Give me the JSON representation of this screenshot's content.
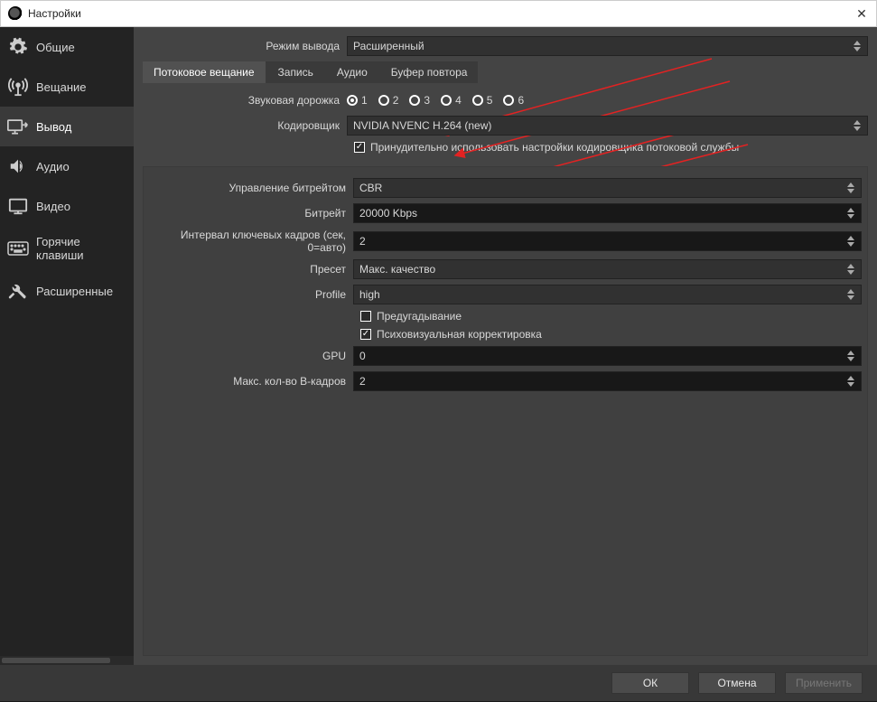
{
  "window": {
    "title": "Настройки"
  },
  "sidebar": {
    "items": [
      {
        "label": "Общие"
      },
      {
        "label": "Вещание"
      },
      {
        "label": "Вывод"
      },
      {
        "label": "Аудио"
      },
      {
        "label": "Видео"
      },
      {
        "label": "Горячие клавиши"
      },
      {
        "label": "Расширенные"
      }
    ],
    "active_index": 2
  },
  "output_mode": {
    "label": "Режим вывода",
    "value": "Расширенный"
  },
  "tabs": [
    {
      "label": "Потоковое вещание"
    },
    {
      "label": "Запись"
    },
    {
      "label": "Аудио"
    },
    {
      "label": "Буфер повтора"
    }
  ],
  "active_tab_index": 0,
  "audio_track": {
    "label": "Звуковая дорожка",
    "options": [
      "1",
      "2",
      "3",
      "4",
      "5",
      "6"
    ],
    "selected_index": 0
  },
  "encoder": {
    "label": "Кодировщик",
    "value": "NVIDIA NVENC H.264 (new)"
  },
  "enforce_checkbox": {
    "checked": true,
    "label": "Принудительно использовать настройки кодировщика потоковой службы"
  },
  "panel": {
    "rate_control": {
      "label": "Управление битрейтом",
      "value": "CBR"
    },
    "bitrate": {
      "label": "Битрейт",
      "value": "20000 Kbps"
    },
    "keyframe": {
      "label": "Интервал ключевых кадров (сек, 0=авто)",
      "value": "2"
    },
    "preset": {
      "label": "Пресет",
      "value": "Макс. качество"
    },
    "profile": {
      "label": "Profile",
      "value": "high"
    },
    "lookahead": {
      "checked": false,
      "label": "Предугадывание"
    },
    "psycho": {
      "checked": true,
      "label": "Психовизуальная корректировка"
    },
    "gpu": {
      "label": "GPU",
      "value": "0"
    },
    "bframes": {
      "label": "Макс. кол-во В-кадров",
      "value": "2"
    }
  },
  "buttons": {
    "ok": "ОК",
    "cancel": "Отмена",
    "apply": "Применить"
  },
  "accent": {
    "arrow_color": "#e32222"
  }
}
